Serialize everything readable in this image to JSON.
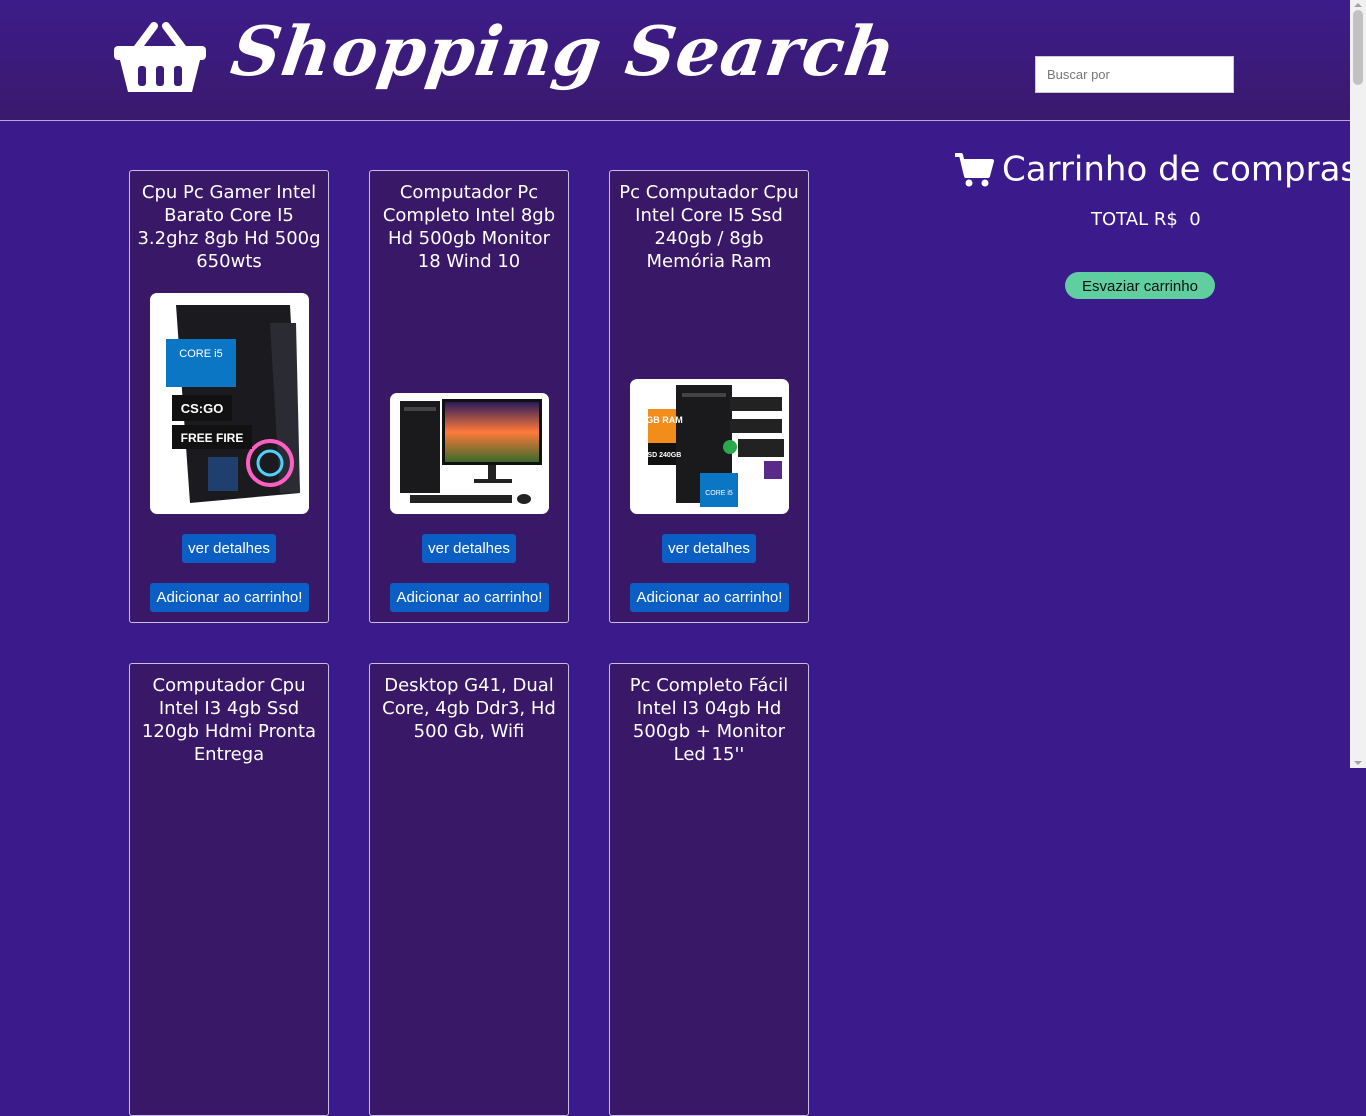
{
  "header": {
    "logo_text": "Shopping Search",
    "logo_icon": "basket-icon",
    "search": {
      "placeholder": "Buscar por",
      "value": ""
    }
  },
  "products": [
    {
      "title": "Cpu Pc Gamer Intel Barato Core I5 3.2ghz 8gb Hd 500g 650wts",
      "image_labels": [
        "CORE i5",
        "CS:GO",
        "FREE FIRE"
      ],
      "details_label": "ver detalhes",
      "add_label": "Adicionar ao carrinho!"
    },
    {
      "title": "Computador Pc Completo Intel 8gb Hd 500gb Monitor 18 Wind 10",
      "details_label": "ver detalhes",
      "add_label": "Adicionar ao carrinho!"
    },
    {
      "title": "Pc Computador Cpu Intel Core I5 Ssd 240gb / 8gb Memória Ram",
      "image_labels": [
        "8GB RAM",
        "SSD 240GB",
        "CORE i5"
      ],
      "details_label": "ver detalhes",
      "add_label": "Adicionar ao carrinho!"
    },
    {
      "title": "Computador Cpu Intel I3 4gb Ssd 120gb Hdmi Pronta Entrega"
    },
    {
      "title": "Desktop G41, Dual Core, 4gb Ddr3, Hd 500 Gb, Wifi"
    },
    {
      "title": "Pc Completo Fácil Intel I3 04gb Hd 500gb + Monitor Led 15''"
    }
  ],
  "cart": {
    "title": "Carrinho de compras",
    "icon": "shopping-cart-icon",
    "total_label": "TOTAL R$",
    "total_value": "0",
    "empty_label": "Esvaziar carrinho"
  },
  "colors": {
    "background": "#3b1a8c",
    "card": "#3a1868",
    "button": "#0b5fc4",
    "empty_button": "#5fcf9f"
  }
}
